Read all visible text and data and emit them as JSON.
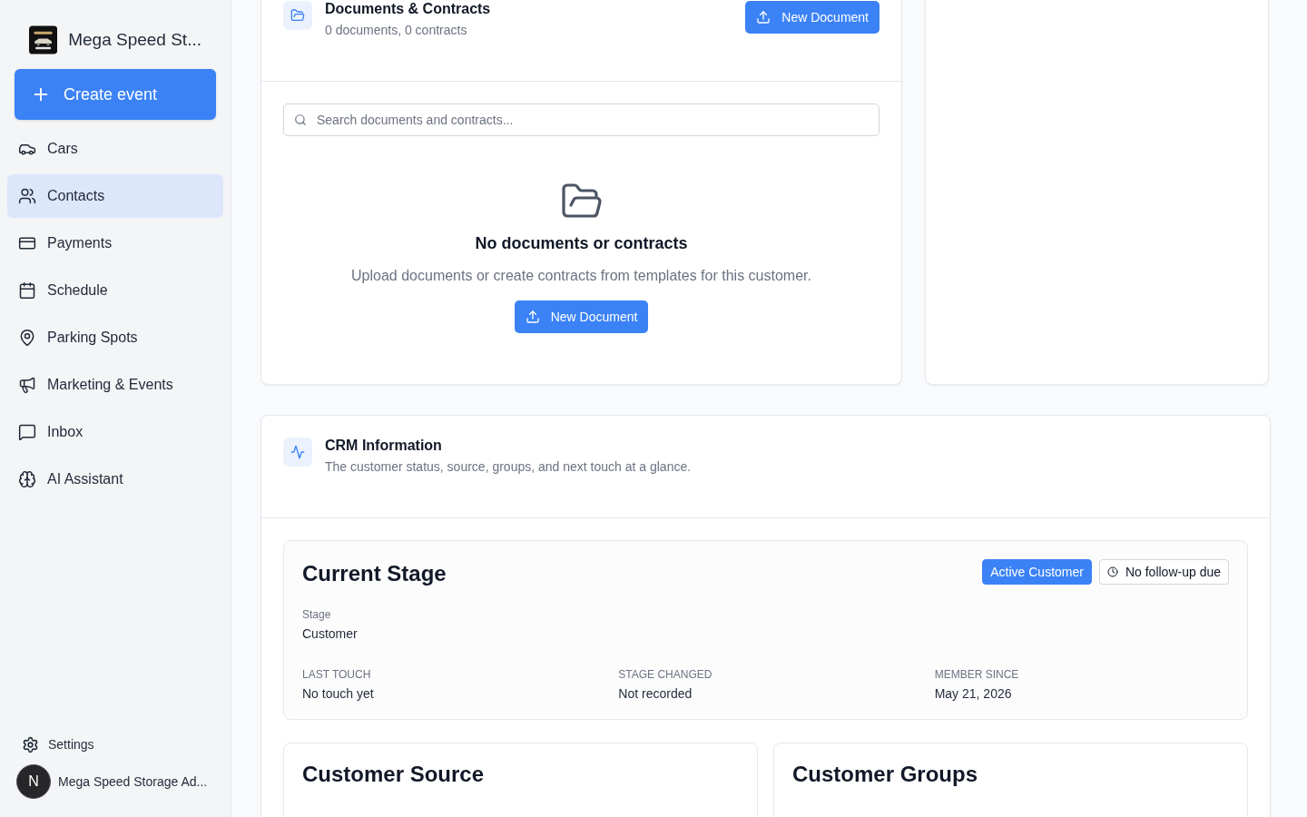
{
  "sidebar": {
    "brand": "Mega Speed St...",
    "create_button": "Create event",
    "items": [
      {
        "label": "Cars",
        "selected": false
      },
      {
        "label": "Contacts",
        "selected": true
      },
      {
        "label": "Payments",
        "selected": false
      },
      {
        "label": "Schedule",
        "selected": false
      },
      {
        "label": "Parking Spots",
        "selected": false
      },
      {
        "label": "Marketing & Events",
        "selected": false
      },
      {
        "label": "Inbox",
        "selected": false
      },
      {
        "label": "AI Assistant",
        "selected": false
      }
    ],
    "settings": "Settings",
    "user": {
      "initial": "N",
      "name": "Mega Speed Storage Ad..."
    }
  },
  "documents": {
    "title": "Documents & Contracts",
    "subtitle": "0 documents, 0 contracts",
    "new_button": "New Document",
    "search": {
      "placeholder": "Search documents and contracts..."
    },
    "empty": {
      "title": "No documents or contracts",
      "text": "Upload documents or create contracts from templates for this customer.",
      "button": "New Document"
    }
  },
  "crm": {
    "title": "CRM Information",
    "subtitle": "The customer status, source, groups, and next touch at a glance.",
    "current_stage": {
      "title": "Current Stage",
      "badges": [
        {
          "label": "Active Customer",
          "kind": "status"
        },
        {
          "label": "No follow-up due",
          "kind": "followup"
        }
      ],
      "stage_label": "Stage",
      "stage_value": "Customer",
      "facts": [
        {
          "label": "LAST TOUCH",
          "value": "No touch yet"
        },
        {
          "label": "STAGE CHANGED",
          "value": "Not recorded"
        },
        {
          "label": "MEMBER SINCE",
          "value": "May 21, 2026"
        }
      ]
    },
    "cards": [
      {
        "title": "Customer Source"
      },
      {
        "title": "Customer Groups"
      }
    ]
  }
}
